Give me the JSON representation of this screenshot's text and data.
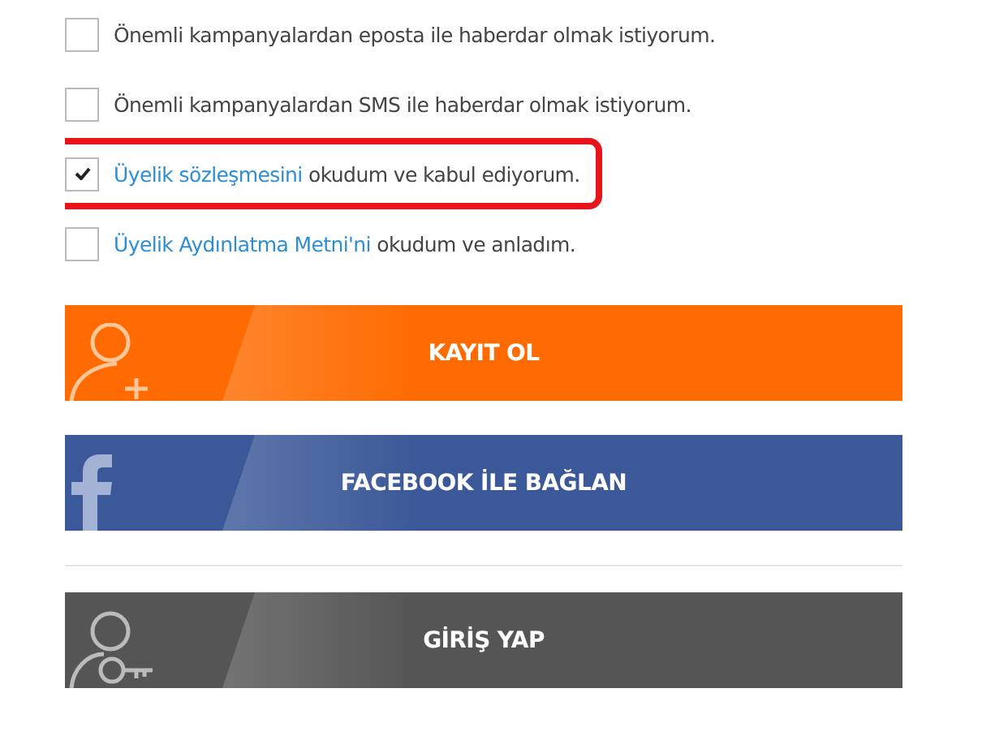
{
  "consents": [
    {
      "text": "Önemli kampanyalardan eposta ile haberdar olmak istiyorum.",
      "checked": false,
      "highlighted": false
    },
    {
      "text": "Önemli kampanyalardan SMS ile haberdar olmak istiyorum.",
      "checked": false,
      "highlighted": false
    },
    {
      "link": "Üyelik sözleşmesini",
      "text": "okudum ve kabul ediyorum.",
      "checked": true,
      "highlighted": true
    },
    {
      "link": "Üyelik Aydınlatma Metni'ni",
      "text": "okudum ve anladım.",
      "checked": false,
      "highlighted": false
    }
  ],
  "buttons": [
    {
      "kind": "register",
      "label": "KAYIT OL"
    },
    {
      "kind": "facebook",
      "label": "FACEBOOK İLE BAĞLAN"
    },
    {
      "kind": "divider"
    },
    {
      "kind": "login",
      "label": "GİRİŞ YAP"
    }
  ]
}
